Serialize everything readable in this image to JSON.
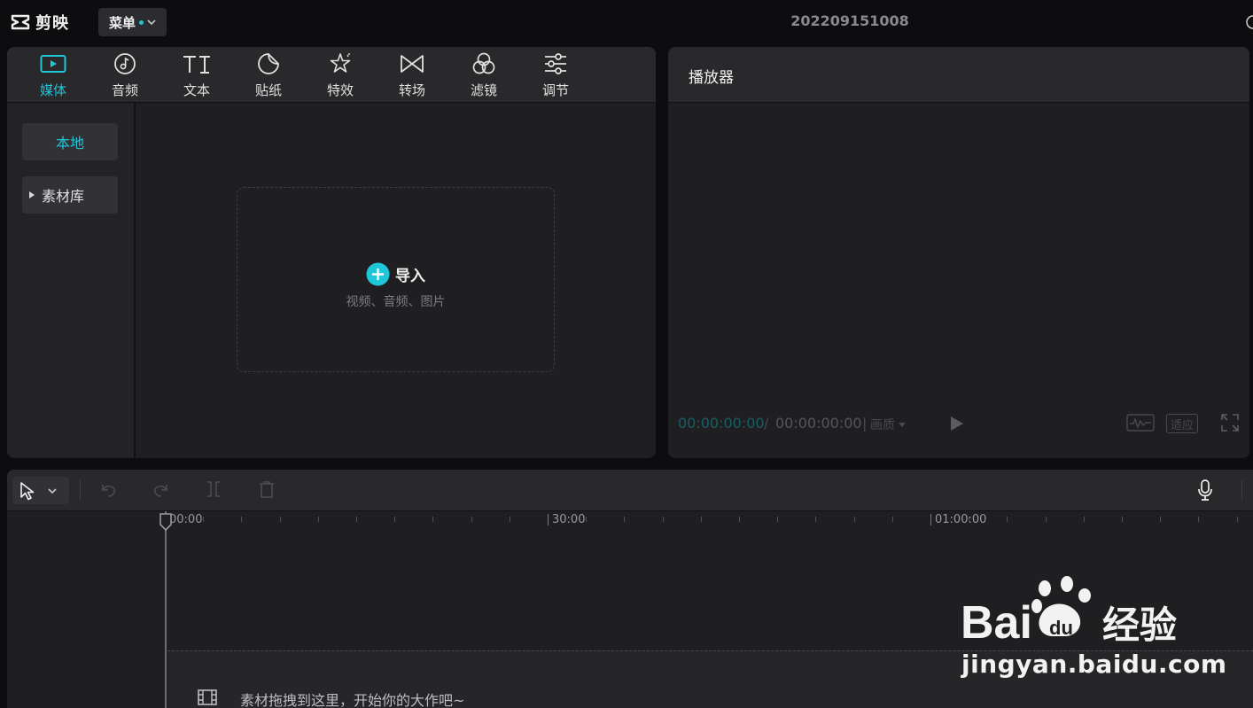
{
  "app": {
    "logo_text": "剪映",
    "menu_label": "菜单",
    "project_title": "202209151008"
  },
  "media_tabs": [
    {
      "label": "媒体",
      "icon": "media-icon",
      "active": true
    },
    {
      "label": "音频",
      "icon": "audio-icon"
    },
    {
      "label": "文本",
      "icon": "text-icon"
    },
    {
      "label": "贴纸",
      "icon": "sticker-icon"
    },
    {
      "label": "特效",
      "icon": "effects-icon"
    },
    {
      "label": "转场",
      "icon": "transition-icon"
    },
    {
      "label": "滤镜",
      "icon": "filter-icon"
    },
    {
      "label": "调节",
      "icon": "adjust-icon"
    }
  ],
  "media_side": {
    "local": "本地",
    "library": "素材库"
  },
  "import": {
    "label": "导入",
    "sub": "视频、音频、图片"
  },
  "player": {
    "title": "播放器",
    "time_current": "00:00:00:00",
    "separator": "/",
    "time_total": "00:00:00:00",
    "bar": "|",
    "quality": "画质",
    "fit": "适应"
  },
  "timeline": {
    "ruler_labels": [
      "00:00",
      "30:00",
      "01:00:00"
    ],
    "drop_hint": "素材拖拽到这里，开始你的大作吧~"
  },
  "watermark": {
    "brand": "Bai du 经验",
    "url": "jingyan.baidu.com"
  },
  "colors": {
    "accent": "#1fc6d8",
    "panel": "#1f1f21",
    "header": "#29292c",
    "background": "#0d0d0f"
  }
}
